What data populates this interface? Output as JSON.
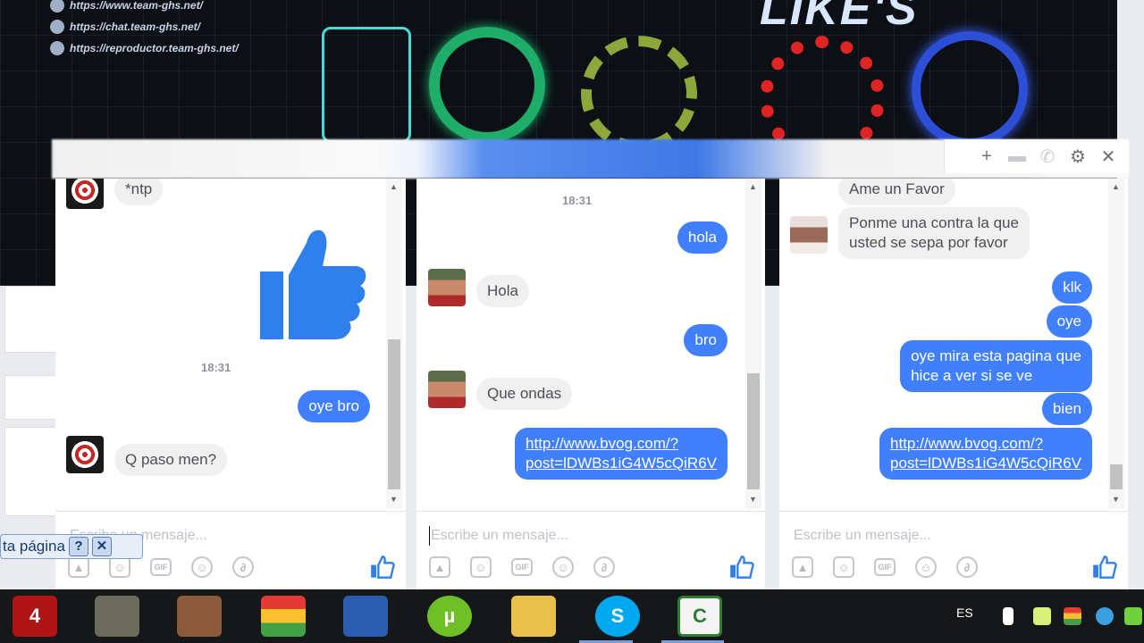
{
  "banner": {
    "links": [
      "https://www.team-ghs.net/",
      "https://chat.team-ghs.net/",
      "https://reproductor.team-ghs.net/"
    ],
    "logo_text": "LIKE'S"
  },
  "chat_header": {
    "icons": [
      "plus-icon",
      "video-icon",
      "phone-icon",
      "gear-icon",
      "close-icon"
    ],
    "labels": {
      "add": "+",
      "video": "▬",
      "phone": "✆",
      "settings": "⚙",
      "close": "✕"
    }
  },
  "colors": {
    "messenger_blue": "#4080ff",
    "incoming_bubble": "#f1f0f0",
    "taskbar": "#161719"
  },
  "chat1": {
    "messages": [
      {
        "dir": "in",
        "text": "*ntp"
      },
      {
        "dir": "out",
        "type": "thumbs-up-sticker"
      },
      {
        "type": "time",
        "text": "18:31"
      },
      {
        "dir": "out",
        "text": "oye bro"
      },
      {
        "dir": "in",
        "text": "Q paso men?"
      }
    ],
    "composer_placeholder": "Escribe un mensaje..."
  },
  "chat2": {
    "messages": [
      {
        "type": "time",
        "text": "18:31"
      },
      {
        "dir": "out",
        "text": "hola"
      },
      {
        "dir": "in",
        "text": "Hola"
      },
      {
        "dir": "out",
        "text": "bro"
      },
      {
        "dir": "in",
        "text": "Que ondas"
      },
      {
        "dir": "out",
        "link_line1": "http://www.bvog.com/?",
        "link_line2": "post=lDWBs1iG4W5cQiR6V"
      }
    ],
    "composer_placeholder": "Escribe un mensaje..."
  },
  "chat3": {
    "messages": [
      {
        "dir": "in",
        "text": "Ame un Favor"
      },
      {
        "dir": "in",
        "line1": "Ponme una contra la que",
        "line2": "usted se sepa por favor"
      },
      {
        "dir": "out",
        "text": "klk"
      },
      {
        "dir": "out",
        "text": "oye"
      },
      {
        "dir": "out",
        "line1": "oye mira esta pagina que",
        "line2": "hice a ver si se ve"
      },
      {
        "dir": "out",
        "text": "bien"
      },
      {
        "dir": "out",
        "link_line1": "http://www.bvog.com/?",
        "link_line2": "post=lDWBs1iG4W5cQiR6V"
      }
    ],
    "composer_placeholder": "Escribe un mensaje..."
  },
  "composer_tools": {
    "gif": "GIF"
  },
  "tooltip": {
    "text": "ta página",
    "help": "?",
    "close": "✕"
  },
  "taskbar": {
    "apps": [
      "left4dead-icon",
      "wings-icon",
      "gta-icon",
      "bluestacks-icon",
      "virtualbox-icon",
      "utorrent-icon",
      "file-explorer-icon",
      "skype-icon",
      "camtasia-icon"
    ],
    "labels": {
      "l4d": "4",
      "utorrent": "µ",
      "skype": "S",
      "camtasia": "C"
    },
    "lang": "ES"
  }
}
